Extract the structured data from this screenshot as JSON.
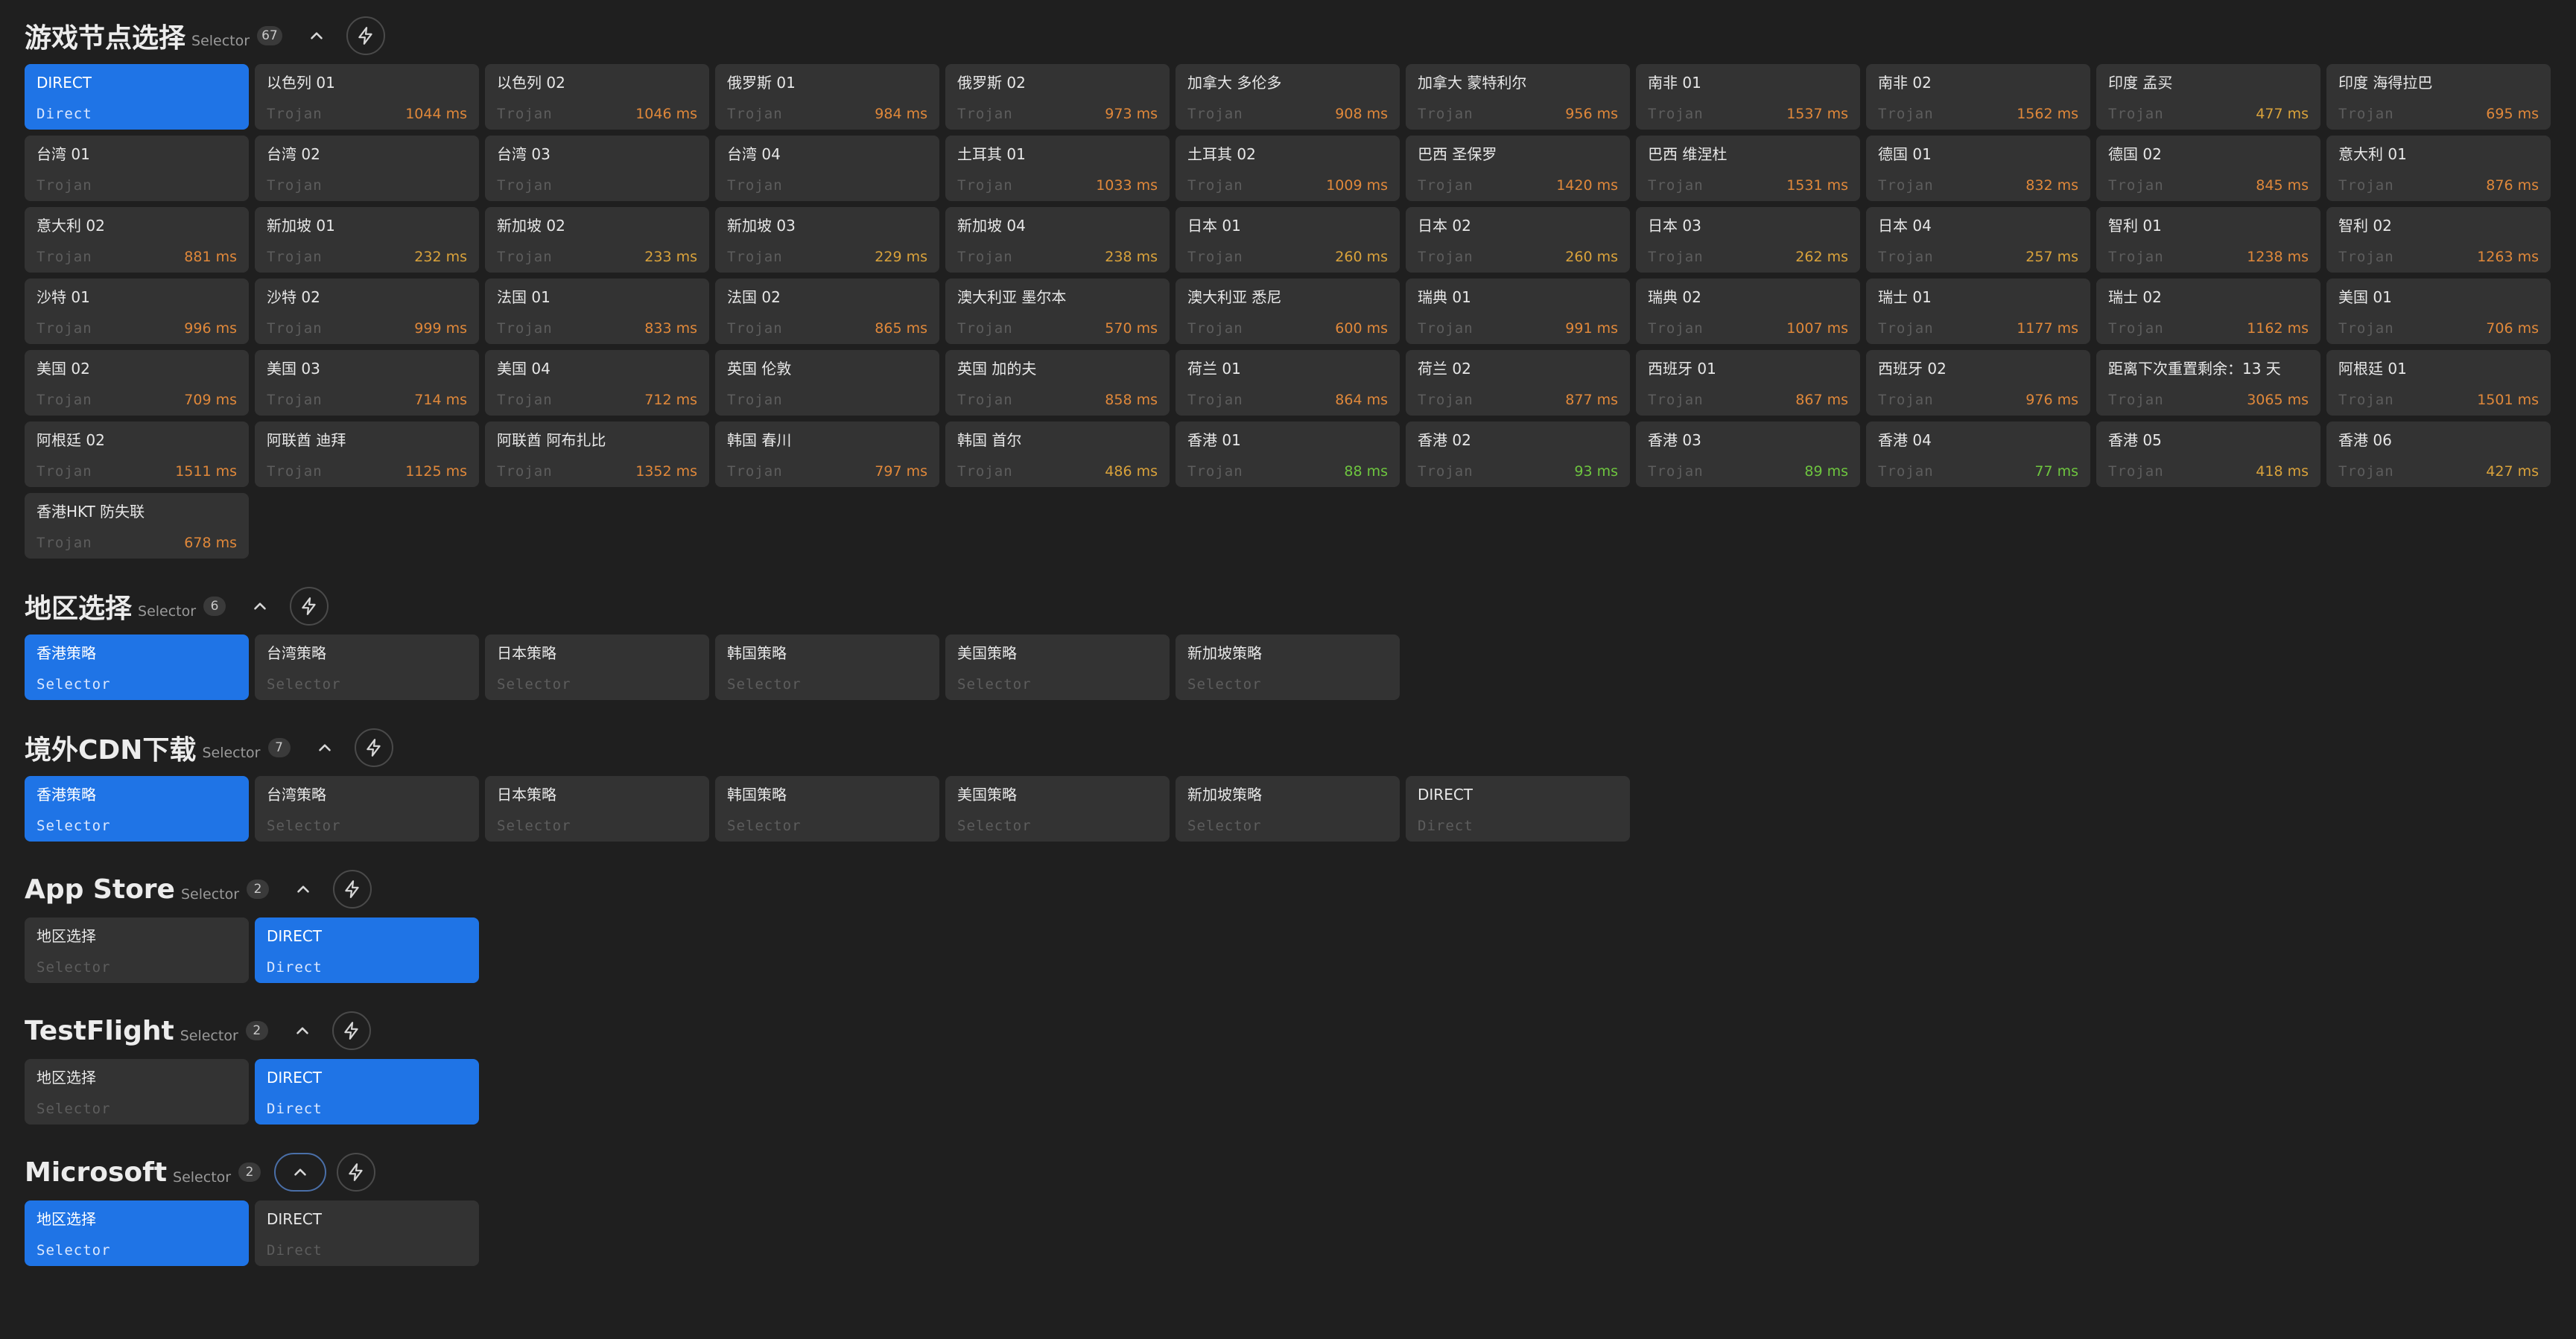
{
  "colors": {
    "background": "#1f1f1f",
    "card": "#333333",
    "selected": "#1f74e6",
    "delay_green": "#6ec63f",
    "delay_orange": "#e0883a",
    "delay_amber": "#d9a23b"
  },
  "groups": [
    {
      "title": "游戏节点选择",
      "type": "Selector",
      "count": "67",
      "collapse_icon": "chevron-up-icon",
      "test_icon": "lightning-icon",
      "collapse_focused": false,
      "nodes": [
        {
          "name": "DIRECT",
          "type": "Direct",
          "delay": "",
          "selected": true
        },
        {
          "name": "以色列 01",
          "type": "Trojan",
          "delay": "1044 ms"
        },
        {
          "name": "以色列 02",
          "type": "Trojan",
          "delay": "1046 ms"
        },
        {
          "name": "俄罗斯 01",
          "type": "Trojan",
          "delay": "984 ms"
        },
        {
          "name": "俄罗斯 02",
          "type": "Trojan",
          "delay": "973 ms"
        },
        {
          "name": "加拿大 多伦多",
          "type": "Trojan",
          "delay": "908 ms"
        },
        {
          "name": "加拿大 蒙特利尔",
          "type": "Trojan",
          "delay": "956 ms"
        },
        {
          "name": "南非 01",
          "type": "Trojan",
          "delay": "1537 ms"
        },
        {
          "name": "南非 02",
          "type": "Trojan",
          "delay": "1562 ms"
        },
        {
          "name": "印度 孟买",
          "type": "Trojan",
          "delay": "477 ms"
        },
        {
          "name": "印度 海得拉巴",
          "type": "Trojan",
          "delay": "695 ms"
        },
        {
          "name": "台湾 01",
          "type": "Trojan",
          "delay": ""
        },
        {
          "name": "台湾 02",
          "type": "Trojan",
          "delay": ""
        },
        {
          "name": "台湾 03",
          "type": "Trojan",
          "delay": ""
        },
        {
          "name": "台湾 04",
          "type": "Trojan",
          "delay": ""
        },
        {
          "name": "土耳其 01",
          "type": "Trojan",
          "delay": "1033 ms"
        },
        {
          "name": "土耳其 02",
          "type": "Trojan",
          "delay": "1009 ms"
        },
        {
          "name": "巴西 圣保罗",
          "type": "Trojan",
          "delay": "1420 ms"
        },
        {
          "name": "巴西 维涅杜",
          "type": "Trojan",
          "delay": "1531 ms"
        },
        {
          "name": "德国 01",
          "type": "Trojan",
          "delay": "832 ms"
        },
        {
          "name": "德国 02",
          "type": "Trojan",
          "delay": "845 ms"
        },
        {
          "name": "意大利 01",
          "type": "Trojan",
          "delay": "876 ms"
        },
        {
          "name": "意大利 02",
          "type": "Trojan",
          "delay": "881 ms"
        },
        {
          "name": "新加坡 01",
          "type": "Trojan",
          "delay": "232 ms"
        },
        {
          "name": "新加坡 02",
          "type": "Trojan",
          "delay": "233 ms"
        },
        {
          "name": "新加坡 03",
          "type": "Trojan",
          "delay": "229 ms"
        },
        {
          "name": "新加坡 04",
          "type": "Trojan",
          "delay": "238 ms"
        },
        {
          "name": "日本 01",
          "type": "Trojan",
          "delay": "260 ms"
        },
        {
          "name": "日本 02",
          "type": "Trojan",
          "delay": "260 ms"
        },
        {
          "name": "日本 03",
          "type": "Trojan",
          "delay": "262 ms"
        },
        {
          "name": "日本 04",
          "type": "Trojan",
          "delay": "257 ms"
        },
        {
          "name": "智利 01",
          "type": "Trojan",
          "delay": "1238 ms"
        },
        {
          "name": "智利 02",
          "type": "Trojan",
          "delay": "1263 ms"
        },
        {
          "name": "沙特 01",
          "type": "Trojan",
          "delay": "996 ms"
        },
        {
          "name": "沙特 02",
          "type": "Trojan",
          "delay": "999 ms"
        },
        {
          "name": "法国 01",
          "type": "Trojan",
          "delay": "833 ms"
        },
        {
          "name": "法国 02",
          "type": "Trojan",
          "delay": "865 ms"
        },
        {
          "name": "澳大利亚 墨尔本",
          "type": "Trojan",
          "delay": "570 ms"
        },
        {
          "name": "澳大利亚 悉尼",
          "type": "Trojan",
          "delay": "600 ms"
        },
        {
          "name": "瑞典 01",
          "type": "Trojan",
          "delay": "991 ms"
        },
        {
          "name": "瑞典 02",
          "type": "Trojan",
          "delay": "1007 ms"
        },
        {
          "name": "瑞士 01",
          "type": "Trojan",
          "delay": "1177 ms"
        },
        {
          "name": "瑞士 02",
          "type": "Trojan",
          "delay": "1162 ms"
        },
        {
          "name": "美国 01",
          "type": "Trojan",
          "delay": "706 ms"
        },
        {
          "name": "美国 02",
          "type": "Trojan",
          "delay": "709 ms"
        },
        {
          "name": "美国 03",
          "type": "Trojan",
          "delay": "714 ms"
        },
        {
          "name": "美国 04",
          "type": "Trojan",
          "delay": "712 ms"
        },
        {
          "name": "英国 伦敦",
          "type": "Trojan",
          "delay": ""
        },
        {
          "name": "英国 加的夫",
          "type": "Trojan",
          "delay": "858 ms"
        },
        {
          "name": "荷兰 01",
          "type": "Trojan",
          "delay": "864 ms"
        },
        {
          "name": "荷兰 02",
          "type": "Trojan",
          "delay": "877 ms"
        },
        {
          "name": "西班牙 01",
          "type": "Trojan",
          "delay": "867 ms"
        },
        {
          "name": "西班牙 02",
          "type": "Trojan",
          "delay": "976 ms"
        },
        {
          "name": "距离下次重置剩余：13 天",
          "type": "Trojan",
          "delay": "3065 ms"
        },
        {
          "name": "阿根廷 01",
          "type": "Trojan",
          "delay": "1501 ms"
        },
        {
          "name": "阿根廷 02",
          "type": "Trojan",
          "delay": "1511 ms"
        },
        {
          "name": "阿联酋 迪拜",
          "type": "Trojan",
          "delay": "1125 ms"
        },
        {
          "name": "阿联酋 阿布扎比",
          "type": "Trojan",
          "delay": "1352 ms"
        },
        {
          "name": "韩国 春川",
          "type": "Trojan",
          "delay": "797 ms"
        },
        {
          "name": "韩国 首尔",
          "type": "Trojan",
          "delay": "486 ms"
        },
        {
          "name": "香港 01",
          "type": "Trojan",
          "delay": "88 ms"
        },
        {
          "name": "香港 02",
          "type": "Trojan",
          "delay": "93 ms"
        },
        {
          "name": "香港 03",
          "type": "Trojan",
          "delay": "89 ms"
        },
        {
          "name": "香港 04",
          "type": "Trojan",
          "delay": "77 ms"
        },
        {
          "name": "香港 05",
          "type": "Trojan",
          "delay": "418 ms"
        },
        {
          "name": "香港 06",
          "type": "Trojan",
          "delay": "427 ms"
        },
        {
          "name": "香港HKT 防失联",
          "type": "Trojan",
          "delay": "678 ms"
        }
      ]
    },
    {
      "title": "地区选择",
      "type": "Selector",
      "count": "6",
      "collapse_icon": "chevron-up-icon",
      "test_icon": "lightning-icon",
      "collapse_focused": false,
      "nodes": [
        {
          "name": "香港策略",
          "type": "Selector",
          "delay": "",
          "selected": true
        },
        {
          "name": "台湾策略",
          "type": "Selector",
          "delay": ""
        },
        {
          "name": "日本策略",
          "type": "Selector",
          "delay": ""
        },
        {
          "name": "韩国策略",
          "type": "Selector",
          "delay": ""
        },
        {
          "name": "美国策略",
          "type": "Selector",
          "delay": ""
        },
        {
          "name": "新加坡策略",
          "type": "Selector",
          "delay": ""
        }
      ]
    },
    {
      "title": "境外CDN下载",
      "type": "Selector",
      "count": "7",
      "collapse_icon": "chevron-up-icon",
      "test_icon": "lightning-icon",
      "collapse_focused": false,
      "nodes": [
        {
          "name": "香港策略",
          "type": "Selector",
          "delay": "",
          "selected": true
        },
        {
          "name": "台湾策略",
          "type": "Selector",
          "delay": ""
        },
        {
          "name": "日本策略",
          "type": "Selector",
          "delay": ""
        },
        {
          "name": "韩国策略",
          "type": "Selector",
          "delay": ""
        },
        {
          "name": "美国策略",
          "type": "Selector",
          "delay": ""
        },
        {
          "name": "新加坡策略",
          "type": "Selector",
          "delay": ""
        },
        {
          "name": "DIRECT",
          "type": "Direct",
          "delay": ""
        }
      ]
    },
    {
      "title": "App Store",
      "type": "Selector",
      "count": "2",
      "collapse_icon": "chevron-up-icon",
      "test_icon": "lightning-icon",
      "collapse_focused": false,
      "nodes": [
        {
          "name": "地区选择",
          "type": "Selector",
          "delay": ""
        },
        {
          "name": "DIRECT",
          "type": "Direct",
          "delay": "",
          "selected": true
        }
      ]
    },
    {
      "title": "TestFlight",
      "type": "Selector",
      "count": "2",
      "collapse_icon": "chevron-up-icon",
      "test_icon": "lightning-icon",
      "collapse_focused": false,
      "nodes": [
        {
          "name": "地区选择",
          "type": "Selector",
          "delay": ""
        },
        {
          "name": "DIRECT",
          "type": "Direct",
          "delay": "",
          "selected": true
        }
      ]
    },
    {
      "title": "Microsoft",
      "type": "Selector",
      "count": "2",
      "collapse_icon": "chevron-up-icon",
      "test_icon": "lightning-icon",
      "collapse_focused": true,
      "nodes": [
        {
          "name": "地区选择",
          "type": "Selector",
          "delay": "",
          "selected": true
        },
        {
          "name": "DIRECT",
          "type": "Direct",
          "delay": ""
        }
      ]
    }
  ]
}
